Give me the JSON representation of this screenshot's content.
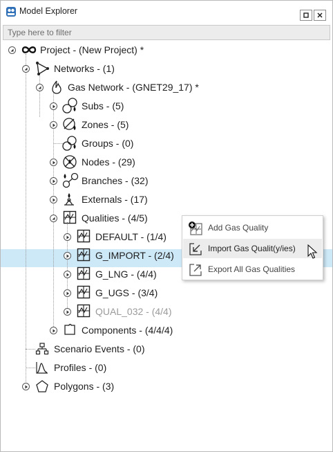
{
  "window": {
    "title": "Model Explorer",
    "app_icon": "model-explorer-icon",
    "controls": [
      "restore-icon",
      "close-icon"
    ]
  },
  "filter": {
    "placeholder": "Type here to filter",
    "value": ""
  },
  "tree": {
    "project": {
      "label": "Project - (New Project) *",
      "icon": "infinity-icon"
    },
    "networks": {
      "label": "Networks - (1)",
      "icon": "network-icon"
    },
    "gas_network": {
      "label": "Gas Network - (GNET29_17) *",
      "icon": "flame-icon"
    },
    "subs": {
      "label": "Subs - (5)",
      "icon": "subs-icon"
    },
    "zones": {
      "label": "Zones - (5)",
      "icon": "zones-icon"
    },
    "groups": {
      "label": "Groups - (0)",
      "icon": "groups-icon"
    },
    "nodes": {
      "label": "Nodes - (29)",
      "icon": "nodes-icon"
    },
    "branches": {
      "label": "Branches - (32)",
      "icon": "branches-icon"
    },
    "externals": {
      "label": "Externals - (17)",
      "icon": "externals-icon"
    },
    "qualities": {
      "label": "Qualities - (4/5)",
      "icon": "quality-icon",
      "selected": true
    },
    "quality_items": [
      {
        "label": "DEFAULT - (1/4)",
        "icon": "quality-icon",
        "disabled": false
      },
      {
        "label": "G_IMPORT - (2/4)",
        "icon": "quality-icon",
        "disabled": false
      },
      {
        "label": "G_LNG - (4/4)",
        "icon": "quality-icon",
        "disabled": false
      },
      {
        "label": "G_UGS - (3/4)",
        "icon": "quality-icon",
        "disabled": false
      },
      {
        "label": "QUAL_032 - (4/4)",
        "icon": "quality-icon",
        "disabled": true
      }
    ],
    "components": {
      "label": "Components - (4/4/4)",
      "icon": "components-icon"
    },
    "scenario_events": {
      "label": "Scenario Events - (0)",
      "icon": "scenario-events-icon"
    },
    "profiles": {
      "label": "Profiles - (0)",
      "icon": "profiles-icon"
    },
    "polygons": {
      "label": "Polygons - (3)",
      "icon": "polygon-icon"
    }
  },
  "context_menu": {
    "items": [
      {
        "label": "Add Gas Quality",
        "icon": "add-quality-icon",
        "state": "normal"
      },
      {
        "label": "Import Gas Qualit(y/ies)",
        "icon": "import-icon",
        "state": "hover"
      },
      {
        "label": "Export All Gas Qualities",
        "icon": "export-icon",
        "state": "normal"
      }
    ]
  },
  "colors": {
    "selection": "#cde8f7",
    "menu_hover": "#ececec",
    "text": "#1e1e1e",
    "disabled_text": "#9b9b9b"
  }
}
